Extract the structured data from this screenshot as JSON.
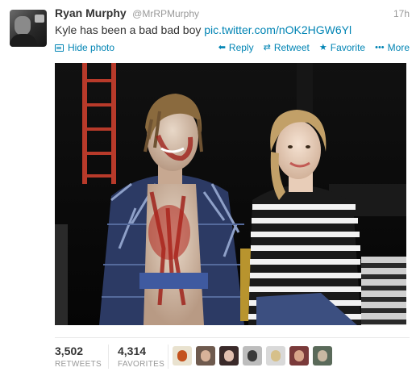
{
  "tweet": {
    "fullname": "Ryan Murphy",
    "username": "@MrRPMurphy",
    "timestamp": "17h",
    "text": "Kyle has been a bad bad boy ",
    "link": "pic.twitter.com/nOK2HGW6Yl"
  },
  "actions": {
    "hide_photo": "Hide photo",
    "reply": "Reply",
    "retweet": "Retweet",
    "favorite": "Favorite",
    "more": "More"
  },
  "icons": {
    "avatar": "profile-avatar",
    "hide_photo": "photo-icon",
    "reply": "reply-arrow-icon",
    "retweet": "retweet-icon",
    "favorite": "star-icon",
    "more": "ellipsis-icon"
  },
  "stats": {
    "retweets_value": "3,502",
    "retweets_label": "RETWEETS",
    "favorites_value": "4,314",
    "favorites_label": "FAVORITES"
  },
  "favoriters": [
    {
      "name": "favoriter-avatar-1",
      "bg": "#e9e2cf",
      "face": "#c4521d"
    },
    {
      "name": "favoriter-avatar-2",
      "bg": "#6e5a4e",
      "face": "#d8b39a"
    },
    {
      "name": "favoriter-avatar-3",
      "bg": "#3a2a2a",
      "face": "#e2c0b0"
    },
    {
      "name": "favoriter-avatar-4",
      "bg": "#bdbdbd",
      "face": "#3a3a3a"
    },
    {
      "name": "favoriter-avatar-5",
      "bg": "#d9d9d9",
      "face": "#d6c08a"
    },
    {
      "name": "favoriter-avatar-6",
      "bg": "#7a3a3a",
      "face": "#d8a58a"
    },
    {
      "name": "favoriter-avatar-7",
      "bg": "#5a6a5a",
      "face": "#c9b8a2"
    }
  ],
  "colors": {
    "link": "#0084b4",
    "muted": "#999999",
    "text": "#333333"
  }
}
